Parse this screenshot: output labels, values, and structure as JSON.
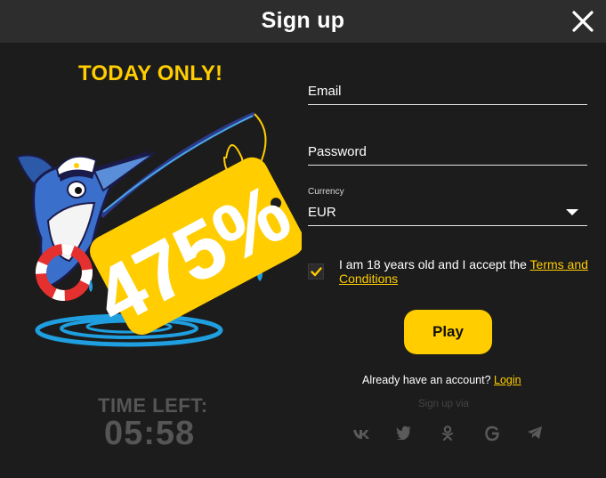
{
  "header": {
    "title": "Sign up"
  },
  "promo": {
    "headline": "TODAY ONLY!",
    "bonus": "475%",
    "time_label": "TIME LEFT:",
    "time_value": "05:58"
  },
  "form": {
    "email_label": "Email",
    "password_label": "Password",
    "currency_label": "Currency",
    "currency_value": "EUR",
    "terms_prefix": "I am 18 years old and I accept the ",
    "terms_link": "Terms and Conditions",
    "checkbox_checked": true,
    "play_label": "Play",
    "already_text": "Already have an account? ",
    "login_link": "Login",
    "signup_via": "Sign up via"
  },
  "social_icons": [
    "vk-icon",
    "twitter-icon",
    "odnoklassniki-icon",
    "google-icon",
    "telegram-icon"
  ],
  "colors": {
    "accent": "#ffcd00",
    "background": "#1c1c1c",
    "header": "#2d2d2d"
  }
}
